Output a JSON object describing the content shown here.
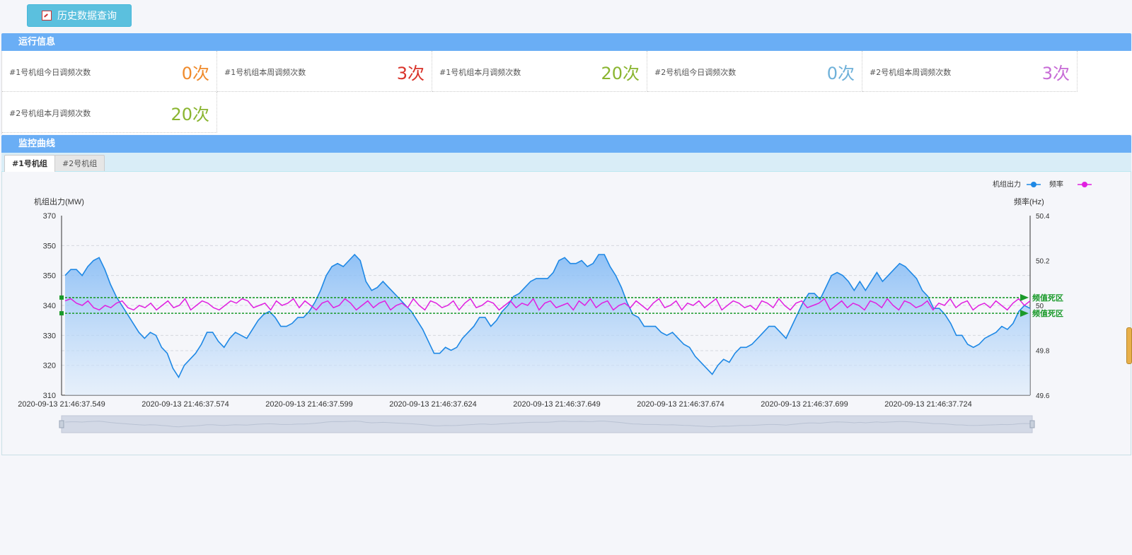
{
  "toolbar": {
    "history_button": "历史数据查询"
  },
  "run_info": {
    "title": "运行信息",
    "stats": [
      {
        "label": "#1号机组今日调频次数",
        "value": "0次",
        "color": "#f08b2c"
      },
      {
        "label": "#1号机组本周调频次数",
        "value": "3次",
        "color": "#d9342b"
      },
      {
        "label": "#1号机组本月调频次数",
        "value": "20次",
        "color": "#8ab530"
      },
      {
        "label": "#2号机组今日调频次数",
        "value": "0次",
        "color": "#6fb1d9"
      },
      {
        "label": "#2号机组本周调频次数",
        "value": "3次",
        "color": "#c76bd6"
      },
      {
        "label": "#2号机组本月调频次数",
        "value": "20次",
        "color": "#8ab530"
      }
    ]
  },
  "monitor": {
    "title": "监控曲线",
    "tabs": [
      {
        "label": "#1号机组",
        "active": true
      },
      {
        "label": "#2号机组",
        "active": false
      }
    ]
  },
  "chart_data": {
    "type": "line",
    "legend": [
      {
        "name": "机组出力",
        "color": "#1e88e5"
      },
      {
        "name": "频率",
        "color": "#e020e0"
      }
    ],
    "legend_position": "top-right",
    "ylabel_left": "机组出力(MW)",
    "ylabel_right": "频率(Hz)",
    "yticks_left": [
      "370",
      "350",
      "350",
      "340",
      "330",
      "320",
      "310"
    ],
    "yticks_right": [
      "50.4",
      "50.2",
      "50",
      "49.8",
      "49.6"
    ],
    "ylim_left": [
      310,
      370
    ],
    "ylim_right": [
      49.6,
      50.4
    ],
    "xticks": [
      "2020-09-13 21:46:37.549",
      "2020-09-13 21:46:37.574",
      "2020-09-13 21:46:37.599",
      "2020-09-13 21:46:37.624",
      "2020-09-13 21:46:37.649",
      "2020-09-13 21:46:37.674",
      "2020-09-13 21:46:37.699",
      "2020-09-13 21:46:37.724"
    ],
    "deadband_label": "频值死区",
    "deadband_hz": [
      50.035,
      49.965
    ],
    "series": [
      {
        "name": "机组出力",
        "values": [
          350,
          352,
          352,
          350,
          353,
          355,
          356,
          352,
          347,
          343,
          340,
          337,
          334,
          331,
          329,
          331,
          330,
          326,
          324,
          319,
          316,
          320,
          322,
          324,
          327,
          331,
          331,
          328,
          326,
          329,
          331,
          330,
          329,
          332,
          335,
          337,
          338,
          336,
          333,
          333,
          334,
          336,
          336,
          338,
          341,
          345,
          350,
          353,
          354,
          353,
          355,
          357,
          355,
          348,
          345,
          346,
          348,
          346,
          344,
          342,
          340,
          338,
          335,
          332,
          328,
          324,
          324,
          326,
          325,
          326,
          329,
          331,
          333,
          336,
          336,
          333,
          335,
          338,
          340,
          343,
          344,
          346,
          348,
          349,
          349,
          349,
          351,
          355,
          356,
          354,
          354,
          355,
          353,
          354,
          357,
          357,
          353,
          350,
          346,
          341,
          337,
          336,
          333,
          333,
          333,
          331,
          330,
          331,
          329,
          327,
          326,
          323,
          321,
          319,
          317,
          320,
          322,
          321,
          324,
          326,
          326,
          327,
          329,
          331,
          333,
          333,
          331,
          329,
          333,
          337,
          341,
          344,
          344,
          342,
          346,
          350,
          351,
          350,
          348,
          345,
          348,
          345,
          348,
          351,
          348,
          350,
          352,
          354,
          353,
          351,
          349,
          345,
          343,
          339,
          339,
          337,
          334,
          330,
          330,
          327,
          326,
          327,
          329,
          330,
          331,
          333,
          332,
          334,
          338,
          340,
          339
        ]
      },
      {
        "name": "频率",
        "values": [
          50.02,
          50.03,
          50.01,
          50.0,
          50.02,
          49.99,
          49.98,
          50.0,
          49.99,
          50.01,
          50.02,
          49.99,
          49.98,
          50.0,
          49.99,
          50.01,
          49.98,
          50.0,
          50.02,
          49.99,
          50.0,
          50.03,
          49.98,
          50.0,
          50.02,
          50.01,
          49.99,
          49.98,
          50.0,
          50.02,
          50.01,
          50.03,
          50.02,
          49.99,
          50.0,
          50.01,
          49.98,
          50.02,
          50.0,
          50.01,
          50.03,
          49.99,
          50.02,
          50.0,
          49.98,
          50.01,
          50.02,
          49.99,
          50.0,
          50.03,
          50.01,
          49.98,
          50.0,
          50.02,
          49.99,
          50.01,
          50.02,
          49.98,
          50.0,
          50.01,
          49.99,
          50.03,
          50.0,
          49.98,
          50.02,
          50.01,
          49.99,
          50.0,
          50.02,
          49.98,
          50.01,
          50.03,
          49.99,
          50.0,
          50.02,
          50.01,
          49.98,
          50.0,
          50.02,
          49.99,
          50.01,
          50.0,
          50.03,
          49.98,
          50.01,
          50.02,
          49.99,
          50.0,
          50.01,
          49.98,
          50.02,
          50.0,
          50.03,
          49.99,
          50.01,
          50.02,
          49.98,
          50.0,
          50.01,
          49.99,
          50.02,
          50.0,
          49.98,
          50.01,
          50.03,
          49.99,
          50.0,
          50.02,
          49.98,
          50.01,
          50.0,
          50.02,
          49.99,
          50.01,
          50.03,
          49.98,
          50.0,
          50.02,
          50.01,
          49.99,
          50.0,
          49.98,
          50.02,
          50.01,
          49.99,
          50.03,
          50.0,
          49.98,
          50.01,
          50.02,
          49.99,
          50.0,
          50.01,
          50.03,
          49.98,
          50.0,
          50.02,
          49.99,
          50.01,
          50.0,
          49.98,
          50.02,
          50.01,
          49.99,
          50.03,
          50.0,
          49.98,
          50.02,
          50.01,
          49.99,
          50.0,
          50.02,
          49.98,
          50.01,
          50.0,
          50.03,
          49.99,
          50.01,
          50.02,
          49.98,
          50.0,
          50.01,
          49.99,
          50.02,
          50.0,
          49.98,
          50.01,
          50.03,
          50.0,
          50.02
        ]
      }
    ]
  }
}
